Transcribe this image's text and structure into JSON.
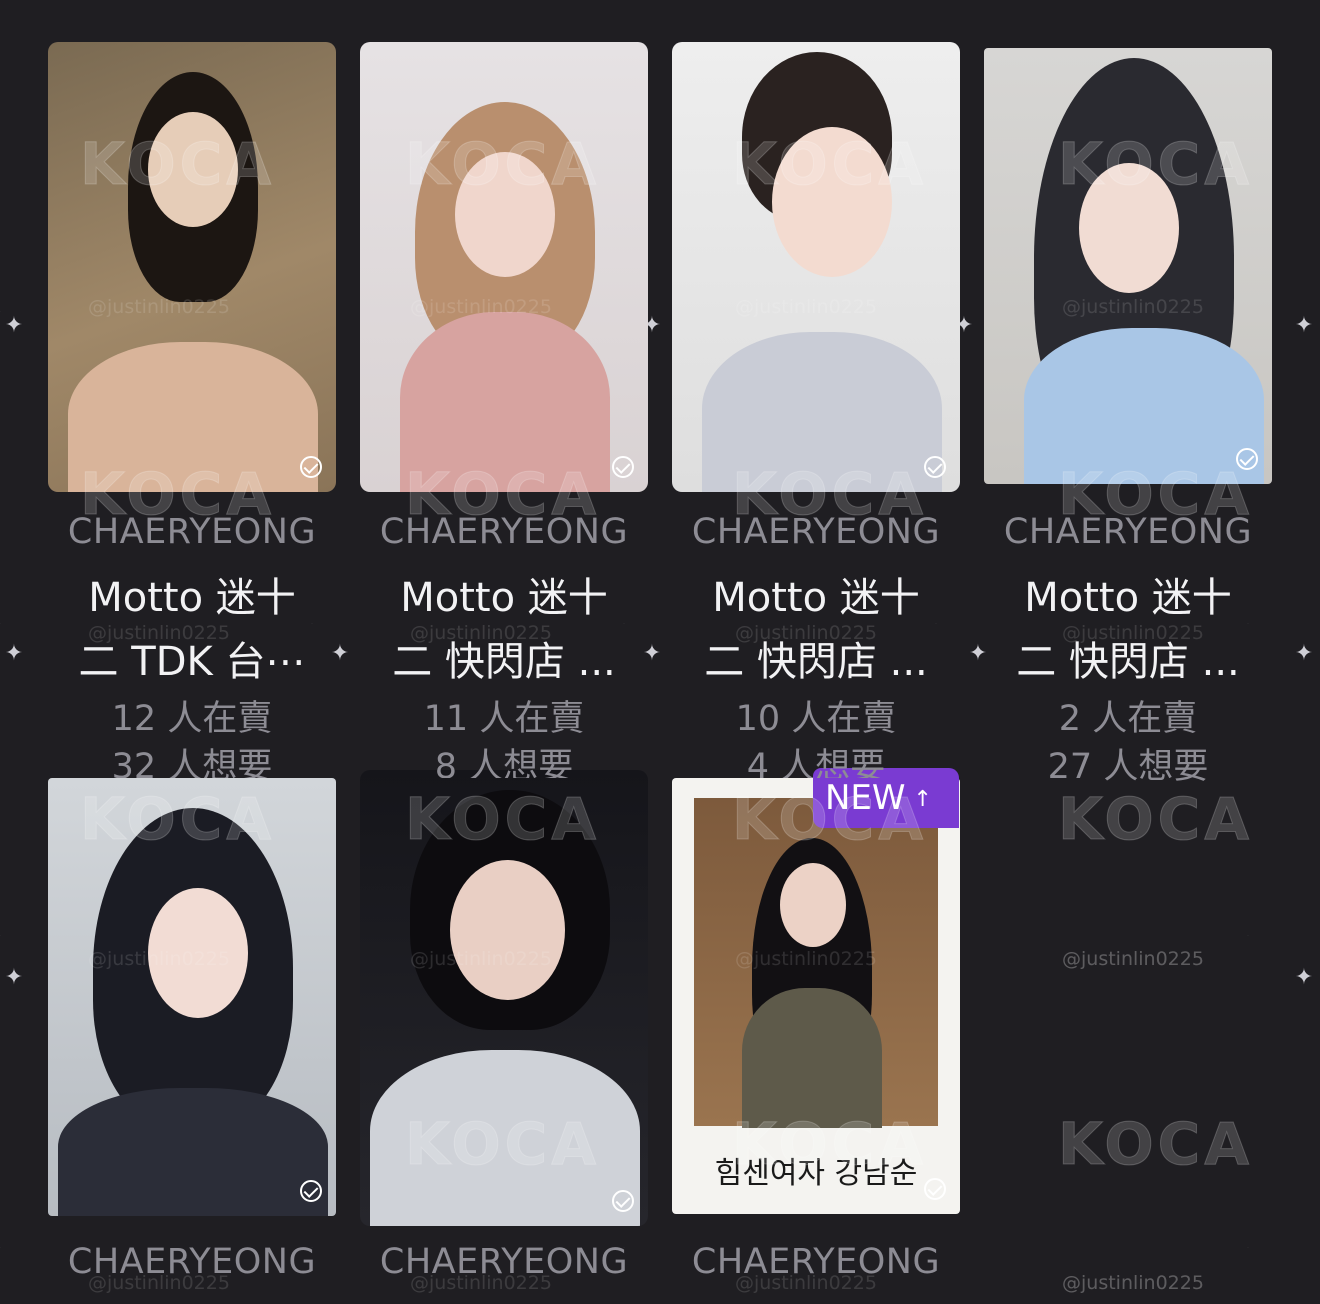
{
  "cards": [
    {
      "group_name": "CHAERYEONG",
      "title_line1": "Motto 迷十",
      "title_line2": "二 TDK 台⋯",
      "selling": "12 人在賣",
      "wanting": "32 人想要"
    },
    {
      "group_name": "CHAERYEONG",
      "title_line1": "Motto 迷十",
      "title_line2": "二 快閃店 ...",
      "selling": "11 人在賣",
      "wanting": "8 人想要"
    },
    {
      "group_name": "CHAERYEONG",
      "title_line1": "Motto 迷十",
      "title_line2": "二 快閃店 ...",
      "selling": "10 人在賣",
      "wanting": "4 人想要"
    },
    {
      "group_name": "CHAERYEONG",
      "title_line1": "Motto 迷十",
      "title_line2": "二 快閃店 ...",
      "selling": "2 人在賣",
      "wanting": "27 人想要"
    },
    {
      "group_name": "CHAERYEONG"
    },
    {
      "group_name": "CHAERYEONG"
    },
    {
      "group_name": "CHAERYEONG",
      "badge": "NEW"
    }
  ],
  "watermark_handle": "@justinlin0225",
  "watermark_logo": "KOCA",
  "polaroid_caption": "힘센여자 강남순",
  "colors": {
    "background": "#1f1e22",
    "badge": "#7a3bd2",
    "muted_text": "#8d8c94"
  }
}
